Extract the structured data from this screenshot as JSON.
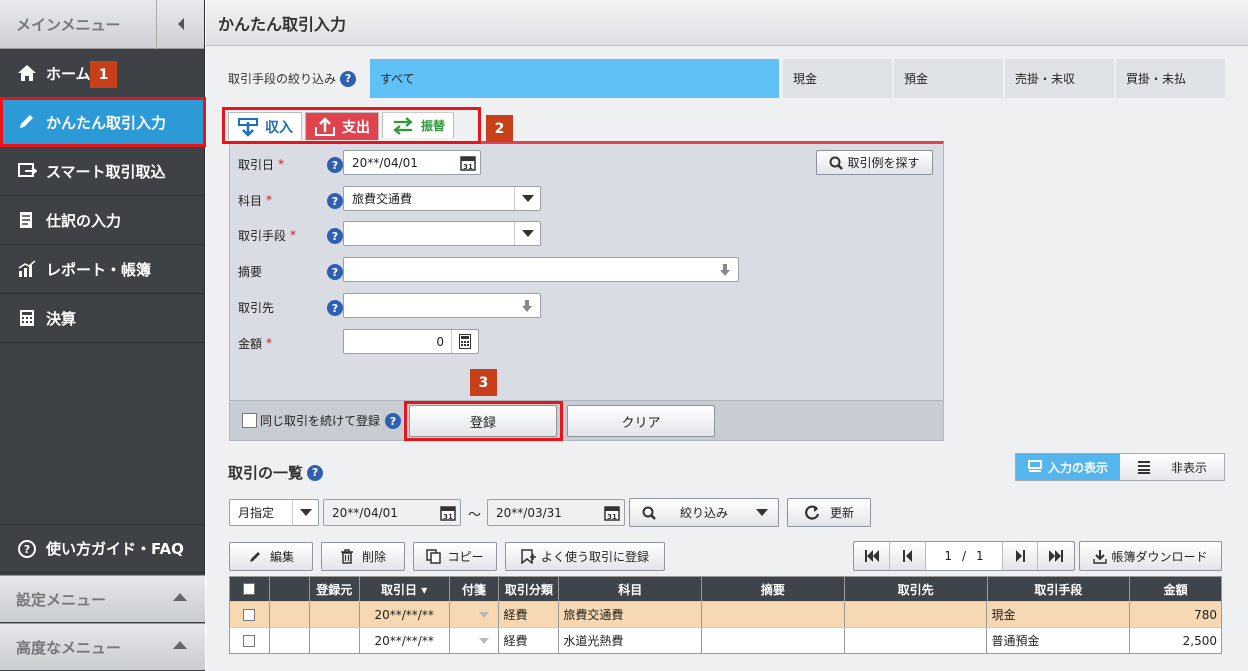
{
  "sidebar": {
    "title": "メインメニュー",
    "items": [
      {
        "label": "ホーム",
        "icon": "home-icon"
      },
      {
        "label": "かんたん取引入力",
        "icon": "pencil-icon"
      },
      {
        "label": "スマート取引取込",
        "icon": "import-icon"
      },
      {
        "label": "仕訳の入力",
        "icon": "journal-icon"
      },
      {
        "label": "レポート・帳簿",
        "icon": "report-icon"
      },
      {
        "label": "決算",
        "icon": "calculator-icon"
      }
    ],
    "guide": "使い方ガイド・FAQ",
    "settings": "設定メニュー",
    "advanced": "高度なメニュー"
  },
  "badges": {
    "b1": "1",
    "b2": "2",
    "b3": "3"
  },
  "header": {
    "title": "かんたん取引入力"
  },
  "filter": {
    "label": "取引手段の絞り込み",
    "options": [
      "すべて",
      "現金",
      "預金",
      "売掛・未収",
      "買掛・未払"
    ],
    "selected": "すべて"
  },
  "tabs": [
    "収入",
    "支出",
    "振替"
  ],
  "form": {
    "date_label": "取引日",
    "date_value": "20**/04/01",
    "example_button": "取引例を探す",
    "account_label": "科目",
    "account_value": "旅費交通費",
    "method_label": "取引手段",
    "method_value": "",
    "memo_label": "摘要",
    "memo_value": "",
    "partner_label": "取引先",
    "partner_value": "",
    "amount_label": "金額",
    "amount_value": "0",
    "repeat_label": "同じ取引を続けて登録",
    "register_button": "登録",
    "clear_button": "クリア"
  },
  "list": {
    "title": "取引の一覧",
    "show_input": "入力の表示",
    "hide": "非表示",
    "period_mode": "月指定",
    "date_from": "20**/04/01",
    "tilde": "～",
    "date_to": "20**/03/31",
    "filter_button": "絞り込み",
    "refresh_button": "更新",
    "edit_button": "編集",
    "delete_button": "削除",
    "copy_button": "コピー",
    "favorite_button": "よく使う取引に登録",
    "page_current": "1",
    "page_sep": "/",
    "page_total": "1",
    "download_button": "帳簿ダウンロード",
    "columns": [
      "",
      "",
      "登録元",
      "取引日 ▾",
      "付箋",
      "取引分類",
      "科目",
      "摘要",
      "取引先",
      "取引手段",
      "金額"
    ],
    "rows": [
      [
        "",
        "",
        "",
        "20**/**/**",
        "",
        "経費",
        "旅費交通費",
        "",
        "",
        "現金",
        "780"
      ],
      [
        "",
        "",
        "",
        "20**/**/**",
        "",
        "経費",
        "水道光熱費",
        "",
        "",
        "普通預金",
        "2,500"
      ]
    ]
  },
  "colors": {
    "accent": "#2c9ad6",
    "expense_red": "#e0434e",
    "highlight": "#e8141c",
    "badge": "#c8401a"
  }
}
